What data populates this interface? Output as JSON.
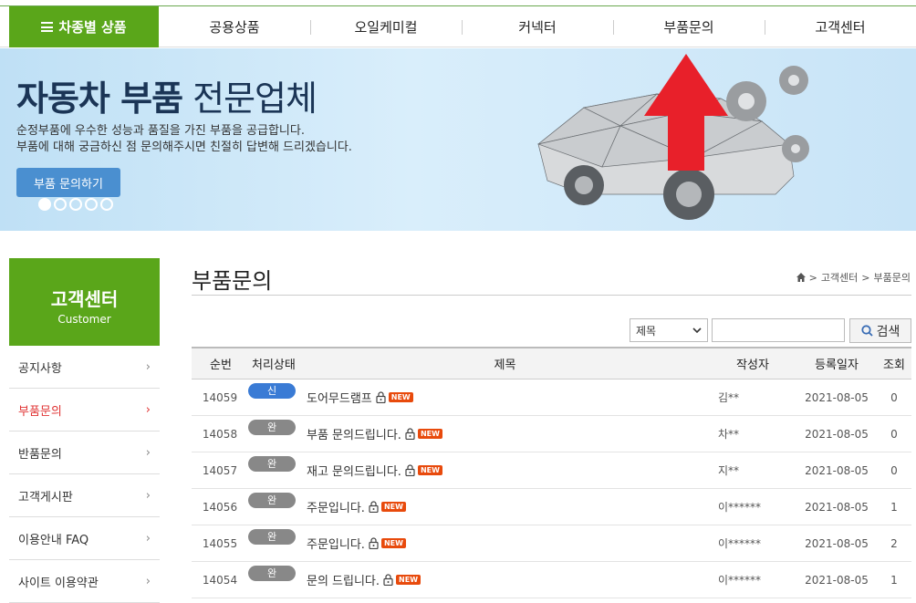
{
  "nav": {
    "category_label": "차종별 상품",
    "items": [
      "공용상품",
      "오일케미컬",
      "커넥터",
      "부품문의",
      "고객센터"
    ]
  },
  "banner": {
    "title_bold": "자동차 부품",
    "title_rest": "전문업체",
    "desc1": "순정부품에 우수한 성능과 품질을 가진 부품을 공급합니다.",
    "desc2": "부품에 대해 궁금하신 점 문의해주시면 친절히 답변해 드리겠습니다.",
    "button": "부품 문의하기",
    "slides": 5,
    "active_slide": 1
  },
  "sidebar": {
    "title": "고객센터",
    "subtitle": "Customer",
    "items": [
      {
        "label": "공지사항",
        "active": false
      },
      {
        "label": "부품문의",
        "active": true
      },
      {
        "label": "반품문의",
        "active": false
      },
      {
        "label": "고객게시판",
        "active": false
      },
      {
        "label": "이용안내 FAQ",
        "active": false
      },
      {
        "label": "사이트 이용약관",
        "active": false
      }
    ],
    "chevron": "›"
  },
  "page": {
    "title": "부품문의",
    "breadcrumb": [
      "고객센터",
      "부품문의"
    ],
    "breadcrumb_sep": ">"
  },
  "search": {
    "select_value": "제목",
    "input_value": "",
    "button": "검색"
  },
  "table": {
    "headers": {
      "no": "순번",
      "status": "처리상태",
      "title": "제목",
      "author": "작성자",
      "date": "등록일자",
      "views": "조회"
    },
    "rows": [
      {
        "no": "14059",
        "status": "신 규",
        "status_type": "new",
        "title": "도어무드램프",
        "new_tag": "NEW",
        "author": "김**",
        "date": "2021-08-05",
        "views": "0"
      },
      {
        "no": "14058",
        "status": "완 료",
        "status_type": "done",
        "title": "부품 문의드립니다.",
        "new_tag": "NEW",
        "author": "차**",
        "date": "2021-08-05",
        "views": "0"
      },
      {
        "no": "14057",
        "status": "완 료",
        "status_type": "done",
        "title": "재고 문의드립니다.",
        "new_tag": "NEW",
        "author": "지**",
        "date": "2021-08-05",
        "views": "0"
      },
      {
        "no": "14056",
        "status": "완 료",
        "status_type": "done",
        "title": "주문입니다.",
        "new_tag": "NEW",
        "author": "이******",
        "date": "2021-08-05",
        "views": "1"
      },
      {
        "no": "14055",
        "status": "완 료",
        "status_type": "done",
        "title": "주문입니다.",
        "new_tag": "NEW",
        "author": "이******",
        "date": "2021-08-05",
        "views": "2"
      },
      {
        "no": "14054",
        "status": "완 료",
        "status_type": "done",
        "title": "문의 드립니다.",
        "new_tag": "NEW",
        "author": "이******",
        "date": "2021-08-05",
        "views": "1"
      }
    ]
  },
  "colors": {
    "brand_green": "#5aa61a",
    "active_red": "#e03333",
    "badge_new": "#3a7bd5",
    "badge_done": "#888888",
    "new_tag": "#e84a0c",
    "annotation_arrow": "#e8202a"
  }
}
